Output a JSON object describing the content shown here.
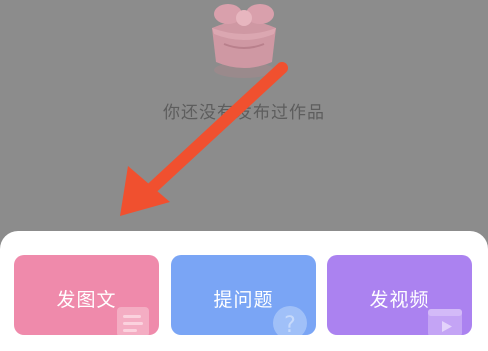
{
  "empty_state": {
    "message": "你还没有发布过作品",
    "illustration": "pink-box-illustration"
  },
  "overlay": {
    "arrow_color": "#f0502f"
  },
  "action_sheet": {
    "actions": [
      {
        "label": "发图文",
        "icon": "image-text-icon",
        "color": "#ef8aab"
      },
      {
        "label": "提问题",
        "icon": "question-icon",
        "color": "#7aa5f5"
      },
      {
        "label": "发视频",
        "icon": "video-icon",
        "color": "#ab82f0"
      }
    ]
  }
}
